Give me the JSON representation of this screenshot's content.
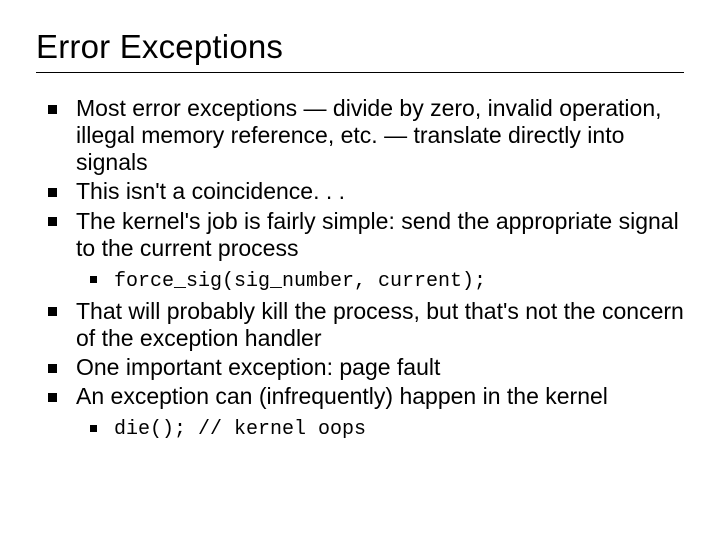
{
  "title": "Error Exceptions",
  "bullets": {
    "b1": "Most error exceptions — divide by zero, invalid operation, illegal memory reference, etc. — translate directly into signals",
    "b2": "This isn't a coincidence. . .",
    "b3": "The kernel's job is fairly simple: send the appropriate signal to the current process",
    "b3_sub": "force_sig(sig_number, current);",
    "b4": "That will probably kill the process, but that's not the concern of the exception handler",
    "b5": "One important exception: page fault",
    "b6": "An exception can (infrequently) happen in the kernel",
    "b6_sub": "die(); // kernel oops"
  }
}
